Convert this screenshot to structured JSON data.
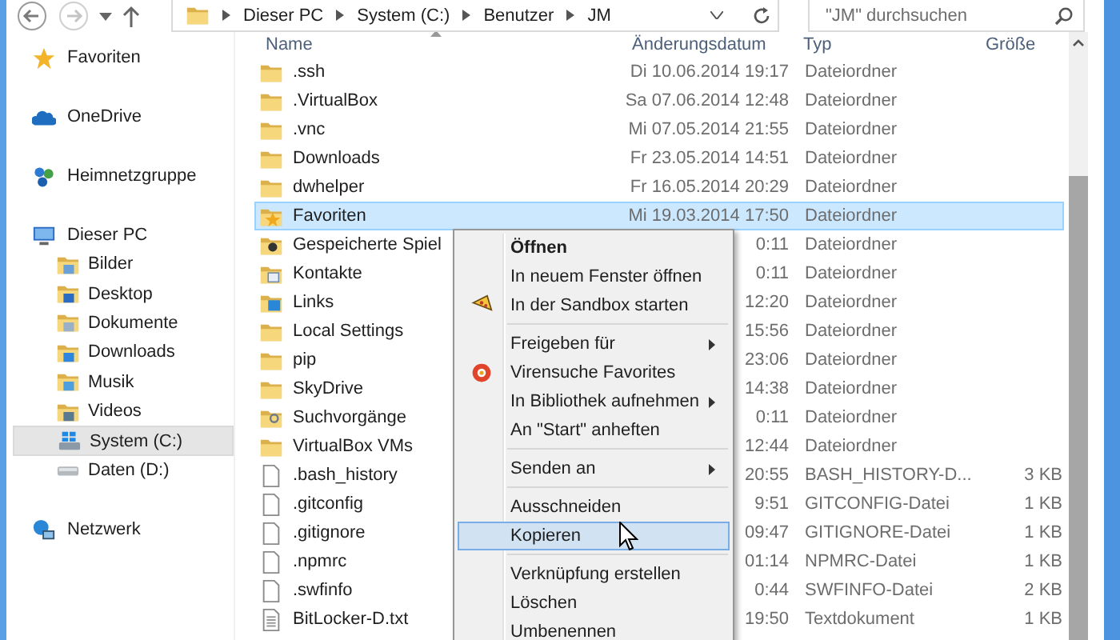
{
  "toolbar": {
    "breadcrumb": [
      "Dieser PC",
      "System (C:)",
      "Benutzer",
      "JM"
    ],
    "search": {
      "placeholder": "\"JM\" durchsuchen"
    }
  },
  "sidebar": {
    "items": [
      {
        "kind": "favorites",
        "label": "Favoriten",
        "selected": false
      },
      {
        "kind": "onedrive",
        "label": "OneDrive",
        "selected": false
      },
      {
        "kind": "homegroup",
        "label": "Heimnetzgruppe",
        "selected": false
      },
      {
        "kind": "pc",
        "label": "Dieser PC",
        "selected": false,
        "children": [
          {
            "kind": "pictures",
            "label": "Bilder",
            "selected": false
          },
          {
            "kind": "desktop",
            "label": "Desktop",
            "selected": false
          },
          {
            "kind": "documents",
            "label": "Dokumente",
            "selected": false
          },
          {
            "kind": "downloads",
            "label": "Downloads",
            "selected": false
          },
          {
            "kind": "music",
            "label": "Musik",
            "selected": false
          },
          {
            "kind": "videos",
            "label": "Videos",
            "selected": false
          },
          {
            "kind": "system-drive",
            "label": "System (C:)",
            "selected": true
          },
          {
            "kind": "drive",
            "label": "Daten (D:)",
            "selected": false
          }
        ]
      },
      {
        "kind": "network",
        "label": "Netzwerk",
        "selected": false
      }
    ]
  },
  "table": {
    "columns": [
      "Name",
      "Änderungsdatum",
      "Typ",
      "Größe"
    ],
    "rows": [
      {
        "kind": "folder",
        "name": ".ssh",
        "date": "Di 10.06.2014 19:17",
        "type": "Dateiordner",
        "selected": false
      },
      {
        "kind": "folder",
        "name": ".VirtualBox",
        "date": "Sa 07.06.2014 12:48",
        "type": "Dateiordner",
        "selected": false
      },
      {
        "kind": "folder",
        "name": ".vnc",
        "date": "Mi 07.05.2014 21:55",
        "type": "Dateiordner",
        "selected": false
      },
      {
        "kind": "folder",
        "name": "Downloads",
        "date": "Fr 23.05.2014 14:51",
        "type": "Dateiordner",
        "selected": false
      },
      {
        "kind": "folder",
        "name": "dwhelper",
        "date": "Fr 16.05.2014 20:29",
        "type": "Dateiordner",
        "selected": false
      },
      {
        "kind": "favorites",
        "name": "Favoriten",
        "date": "Mi 19.03.2014 17:50",
        "type": "Dateiordner",
        "selected": true
      },
      {
        "kind": "games",
        "name": "Gespeicherte Spiel",
        "date": "0:11",
        "type": "Dateiordner",
        "selected": false
      },
      {
        "kind": "contacts",
        "name": "Kontakte",
        "date": "0:11",
        "type": "Dateiordner",
        "selected": false
      },
      {
        "kind": "links",
        "name": "Links",
        "date": "12:20",
        "type": "Dateiordner",
        "selected": false
      },
      {
        "kind": "folder",
        "name": "Local Settings",
        "date": "15:56",
        "type": "Dateiordner",
        "selected": false
      },
      {
        "kind": "folder",
        "name": "pip",
        "date": "23:06",
        "type": "Dateiordner",
        "selected": false
      },
      {
        "kind": "folder",
        "name": "SkyDrive",
        "date": "14:38",
        "type": "Dateiordner",
        "selected": false
      },
      {
        "kind": "search",
        "name": "Suchvorgänge",
        "date": "0:11",
        "type": "Dateiordner",
        "selected": false
      },
      {
        "kind": "folder",
        "name": "VirtualBox VMs",
        "date": "12:44",
        "type": "Dateiordner",
        "selected": false
      },
      {
        "kind": "file",
        "name": ".bash_history",
        "date": "20:55",
        "type": "BASH_HISTORY-D...",
        "size": "3 KB",
        "selected": false
      },
      {
        "kind": "file",
        "name": ".gitconfig",
        "date": "9:51",
        "type": "GITCONFIG-Datei",
        "size": "1 KB",
        "selected": false
      },
      {
        "kind": "file",
        "name": ".gitignore",
        "date": "09:47",
        "type": "GITIGNORE-Datei",
        "size": "1 KB",
        "selected": false
      },
      {
        "kind": "file",
        "name": ".npmrc",
        "date": "01:14",
        "type": "NPMRC-Datei",
        "size": "1 KB",
        "selected": false
      },
      {
        "kind": "file",
        "name": ".swfinfo",
        "date": "0:44",
        "type": "SWFINFO-Datei",
        "size": "2 KB",
        "selected": false
      },
      {
        "kind": "text",
        "name": "BitLocker-D.txt",
        "date": "19:50",
        "type": "Textdokument",
        "size": "1 KB",
        "selected": false
      }
    ]
  },
  "context_menu": {
    "items": [
      {
        "kind": "command",
        "label": "Öffnen",
        "default": true,
        "submenu": false,
        "selected": false
      },
      {
        "kind": "command",
        "label": "In neuem Fenster öffnen",
        "default": false,
        "submenu": false,
        "selected": false
      },
      {
        "kind": "sandbox",
        "label": "In der Sandbox starten",
        "default": false,
        "submenu": false,
        "selected": false
      },
      {
        "kind": "separator"
      },
      {
        "kind": "command",
        "label": "Freigeben für",
        "default": false,
        "submenu": true,
        "selected": false
      },
      {
        "kind": "virus-scan",
        "label": "Virensuche Favorites",
        "default": false,
        "submenu": false,
        "selected": false
      },
      {
        "kind": "command",
        "label": "In Bibliothek aufnehmen",
        "default": false,
        "submenu": true,
        "selected": false
      },
      {
        "kind": "command",
        "label": "An \"Start\" anheften",
        "default": false,
        "submenu": false,
        "selected": false
      },
      {
        "kind": "separator"
      },
      {
        "kind": "command",
        "label": "Senden an",
        "default": false,
        "submenu": true,
        "selected": false
      },
      {
        "kind": "separator"
      },
      {
        "kind": "command",
        "label": "Ausschneiden",
        "default": false,
        "submenu": false,
        "selected": false
      },
      {
        "kind": "command",
        "label": "Kopieren",
        "default": false,
        "submenu": false,
        "selected": true
      },
      {
        "kind": "separator"
      },
      {
        "kind": "command",
        "label": "Verknüpfung erstellen",
        "default": false,
        "submenu": false,
        "selected": false
      },
      {
        "kind": "command",
        "label": "Löschen",
        "default": false,
        "submenu": false,
        "selected": false
      },
      {
        "kind": "command",
        "label": "Umbenennen",
        "default": false,
        "submenu": false,
        "selected": false
      }
    ]
  }
}
